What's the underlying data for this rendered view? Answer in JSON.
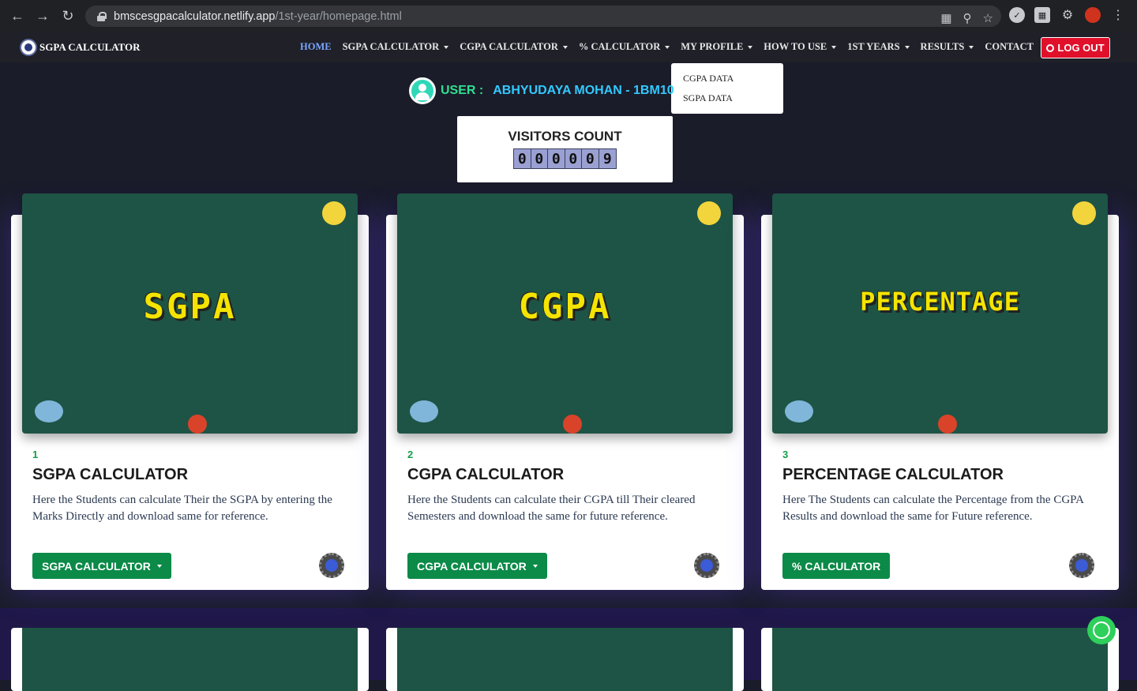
{
  "browser": {
    "url_host": "bmscesgpacalculator.netlify.app",
    "url_path": "/1st-year/homepage.html"
  },
  "navbar": {
    "brand": "SGPA CALCULATOR",
    "items": [
      {
        "label": "HOME",
        "has_caret": false,
        "active": true
      },
      {
        "label": "SGPA CALCULATOR",
        "has_caret": true
      },
      {
        "label": "CGPA CALCULATOR",
        "has_caret": true
      },
      {
        "label": "% CALCULATOR",
        "has_caret": true
      },
      {
        "label": "MY PROFILE",
        "has_caret": true
      },
      {
        "label": "HOW TO USE",
        "has_caret": true
      },
      {
        "label": "1ST YEARS",
        "has_caret": true
      },
      {
        "label": "RESULTS",
        "has_caret": true
      },
      {
        "label": "CONTACT",
        "has_caret": false
      }
    ],
    "logout": "LOG OUT",
    "dropdown": [
      "CGPA DATA",
      "SGPA DATA"
    ]
  },
  "user": {
    "label": "USER :",
    "name": "ABHYUDAYA MOHAN - 1BM10"
  },
  "visitors": {
    "title": "VISITORS COUNT",
    "digits": [
      "0",
      "0",
      "0",
      "0",
      "0",
      "9"
    ]
  },
  "cards": [
    {
      "image_text": "SGPA",
      "number": "1",
      "title": "SGPA CALCULATOR",
      "desc": "Here the Students can calculate Their the SGPA by entering the Marks Directly and download same for reference.",
      "button": "SGPA CALCULATOR",
      "caret": true
    },
    {
      "image_text": "CGPA",
      "number": "2",
      "title": "CGPA CALCULATOR",
      "desc": "Here the Students can calculate their CGPA till Their cleared Semesters and download the same for future reference.",
      "button": "CGPA CALCULATOR",
      "caret": true
    },
    {
      "image_text": "PERCENTAGE",
      "number": "3",
      "title": "PERCENTAGE CALCULATOR",
      "desc": "Here The Students can calculate the Percentage from the CGPA Results and download the same for Future reference.",
      "button": "% CALCULATOR",
      "caret": false
    }
  ],
  "colors": {
    "accent_green": "#0b8a48",
    "logout_red": "#e0102b",
    "active_nav": "#7aa6ff"
  }
}
